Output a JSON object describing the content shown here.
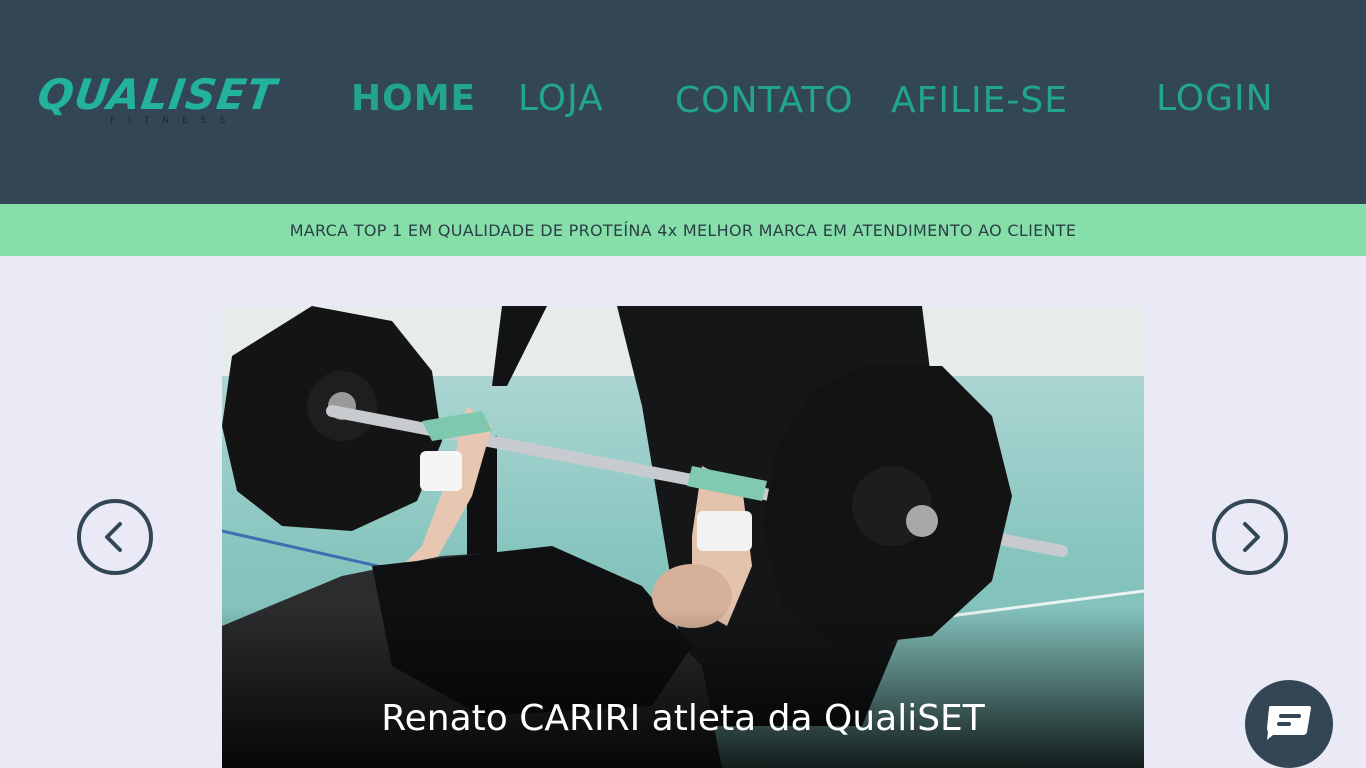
{
  "brand": {
    "name": "QUALISET",
    "tagline": "FITNESS",
    "color": "#22b39a"
  },
  "nav": {
    "items": [
      {
        "label": "HOME",
        "active": true
      },
      {
        "label": "LOJA",
        "active": false
      },
      {
        "label": "CONTATO",
        "active": false
      },
      {
        "label": "AFILIE-SE",
        "active": false
      },
      {
        "label": "LOGIN",
        "active": false
      }
    ]
  },
  "banner": {
    "text": "MARCA TOP 1 EM QUALIDADE DE PROTEÍNA 4x MELHOR MARCA EM ATENDIMENTO AO CLIENTE",
    "color": "#86dfa9"
  },
  "carousel": {
    "caption": "Renato CARIRI atleta da QualiSET",
    "prev_icon": "chevron-left-icon",
    "next_icon": "chevron-right-icon"
  },
  "chat": {
    "icon": "chat-icon"
  },
  "colors": {
    "header": "#324656",
    "nav_text": "#22a58f",
    "page_bg": "#eaeaf6"
  }
}
